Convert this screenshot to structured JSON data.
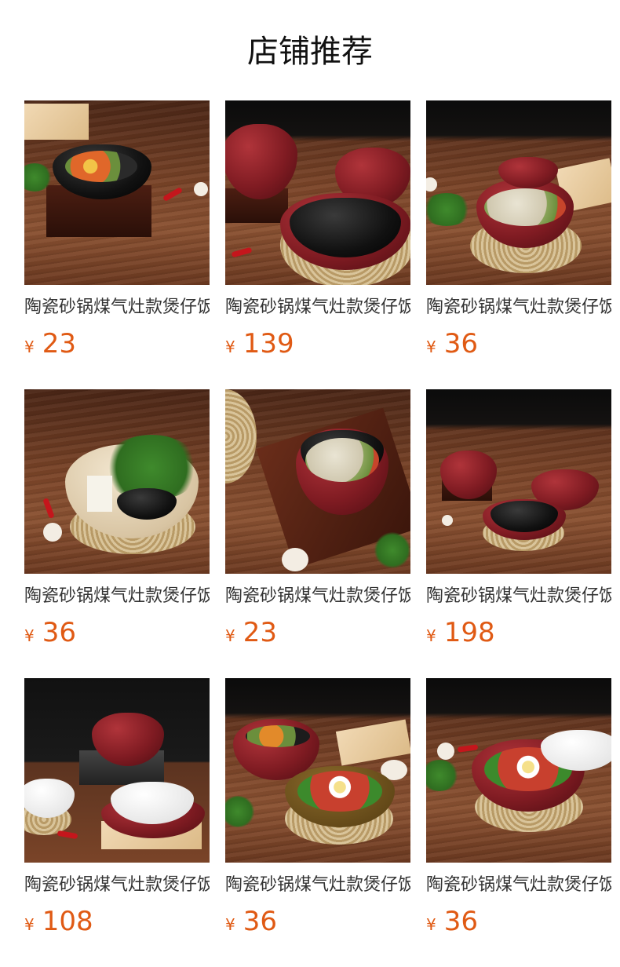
{
  "page": {
    "title": "店铺推荐"
  },
  "colors": {
    "price": "#e05a14",
    "title": "#111111",
    "name": "#333333"
  },
  "products": [
    {
      "name": "陶瓷砂锅煤气灶款煲仔饭",
      "currency": "¥",
      "price": "23"
    },
    {
      "name": "陶瓷砂锅煤气灶款煲仔饭",
      "currency": "¥",
      "price": "139"
    },
    {
      "name": "陶瓷砂锅煤气灶款煲仔饭",
      "currency": "¥",
      "price": "36"
    },
    {
      "name": "陶瓷砂锅煤气灶款煲仔饭",
      "currency": "¥",
      "price": "36"
    },
    {
      "name": "陶瓷砂锅煤气灶款煲仔饭",
      "currency": "¥",
      "price": "23"
    },
    {
      "name": "陶瓷砂锅煤气灶款煲仔饭",
      "currency": "¥",
      "price": "198"
    },
    {
      "name": "陶瓷砂锅煤气灶款煲仔饭",
      "currency": "¥",
      "price": "108"
    },
    {
      "name": "陶瓷砂锅煤气灶款煲仔饭",
      "currency": "¥",
      "price": "36"
    },
    {
      "name": "陶瓷砂锅煤气灶款煲仔饭",
      "currency": "¥",
      "price": "36"
    }
  ]
}
